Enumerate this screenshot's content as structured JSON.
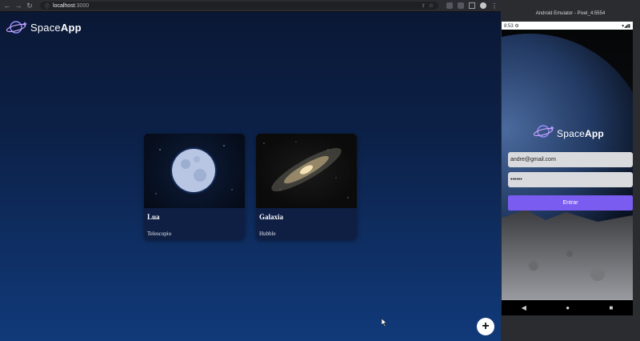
{
  "browser": {
    "url_host": "localhost",
    "url_port": ":3000"
  },
  "app": {
    "logo_regular": "Space",
    "logo_bold": "App",
    "cards": [
      {
        "title": "Lua",
        "subtitle": "Telescopio"
      },
      {
        "title": "Galaxia",
        "subtitle": "Hubble"
      }
    ],
    "fab_label": "+"
  },
  "emulator": {
    "title": "Android Emulator - Pixel_4:5554",
    "time": "8:53",
    "logo_regular": "Space",
    "logo_bold": "App",
    "email_value": "andre@gmail.com",
    "password_value": "••••••",
    "login_button": "Entrar"
  }
}
